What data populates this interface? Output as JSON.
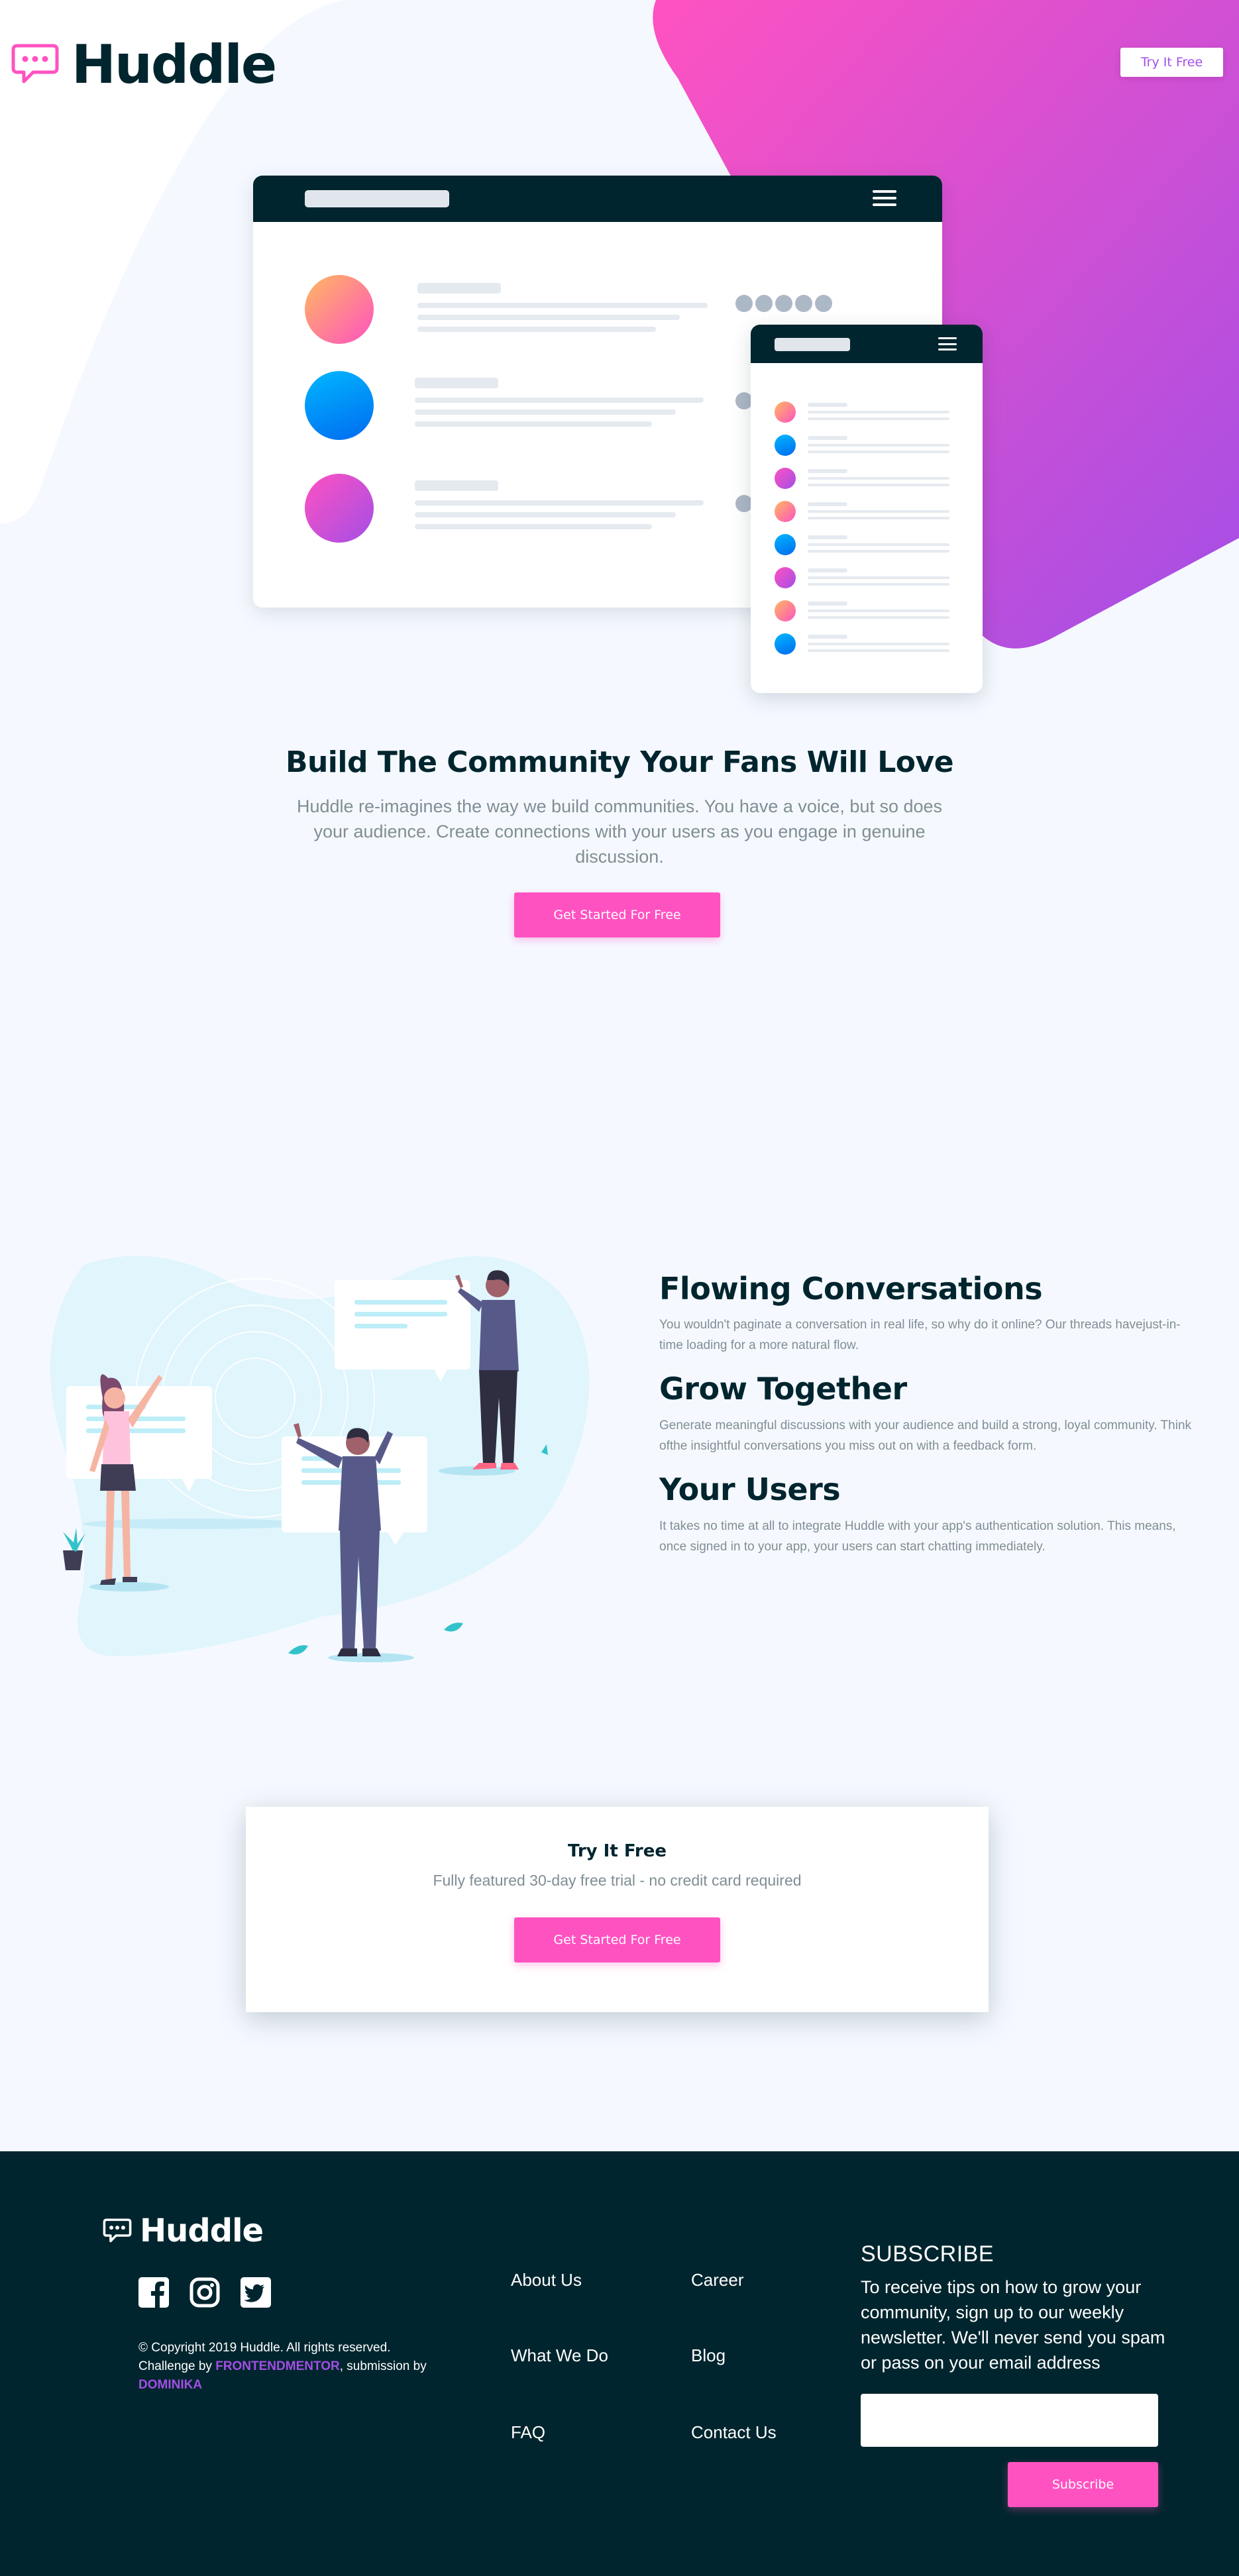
{
  "colors": {
    "brand_dark": "#00252e",
    "pink": "#ff52c1",
    "violet": "#a34ee6",
    "background": "#f5f9ff",
    "muted_text": "#808e94"
  },
  "header": {
    "logo_text": "Huddle",
    "logo_icon": "chat-bubble-icon",
    "try_button": "Try It Free"
  },
  "hero": {
    "title": "Build The Community Your Fans Will Love",
    "description": "Huddle re-imagines the way we build communities. You have a voice, but so does your audience. Create connections with your users as you engage in genuine discussion.",
    "cta": "Get Started For Free"
  },
  "features": [
    {
      "title": "Flowing Conversations",
      "description": "You wouldn't paginate a conversation in real life, so why do it online? Our threads havejust-in-time loading for a more natural flow."
    },
    {
      "title": "Grow Together",
      "description": "Generate meaningful discussions with your audience and build a strong, loyal community. Think ofthe insightful conversations you miss out on with a feedback form."
    },
    {
      "title": "Your Users",
      "description": "It takes no time at all to integrate Huddle with your app's authentication solution. This means, once signed in to your app, your users can start chatting immediately."
    }
  ],
  "cta_card": {
    "title": "Try It Free",
    "subtitle": "Fully featured 30-day free trial - no credit card required",
    "button": "Get Started For Free"
  },
  "footer": {
    "logo_text": "Huddle",
    "socials": [
      "facebook-icon",
      "instagram-icon",
      "twitter-icon"
    ],
    "copyright": "© Copyright 2019 Huddle. All rights reserved.",
    "challenge_prefix": "Challenge by ",
    "challenge_org": "FRONTENDMENTOR",
    "submission_text": ", submission by",
    "author": "DOMINIKA",
    "links_col1": [
      "About Us",
      "What We Do",
      "FAQ"
    ],
    "links_col2": [
      "Career",
      "Blog",
      "Contact Us"
    ],
    "subscribe_title": "SUBSCRIBE",
    "subscribe_desc": "To receive tips on how to grow your community, sign up to our weekly newsletter. We'll never send you spam or pass on your email address",
    "email_value": "",
    "subscribe_button": "Subscribe"
  }
}
